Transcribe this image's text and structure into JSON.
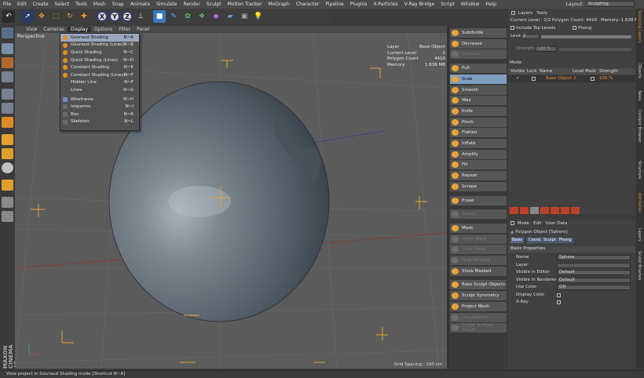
{
  "menubar": {
    "items": [
      "File",
      "Edit",
      "Create",
      "Select",
      "Tools",
      "Mesh",
      "Snap",
      "Animate",
      "Simulate",
      "Render",
      "Sculpt",
      "Motion Tracker",
      "MoGraph",
      "Character",
      "Pipeline",
      "Plugins",
      "X-Particles",
      "V-Ray Bridge",
      "Script",
      "Window",
      "Help"
    ],
    "layout_label": "Layout:",
    "layout_value": "Sculpting"
  },
  "toolbar": {
    "icons": [
      "undo-icon",
      "select-arrow-icon",
      "move-icon",
      "scale-icon",
      "rotate-icon",
      "recent-tools-icon",
      "x-axis-icon",
      "y-axis-icon",
      "z-axis-icon",
      "coordinate-system-icon",
      "cube-icon",
      "pen-icon",
      "subdivision-icon",
      "cloner-icon",
      "deformer-icon",
      "environment-icon",
      "camera-icon",
      "light-icon"
    ],
    "x": "X",
    "y": "Y",
    "z": "Z"
  },
  "viewport_menu": {
    "items": [
      "View",
      "Cameras",
      "Display",
      "Options",
      "Filter",
      "Panel"
    ],
    "active_index": 2
  },
  "viewport": {
    "label": "Perspective",
    "hud": [
      {
        "k": "Layer",
        "v": "Base Object"
      },
      {
        "k": "Current Level",
        "v": "2"
      },
      {
        "k": "Polygon Count",
        "v": "4416"
      },
      {
        "k": "Memory",
        "v": "1.638 MB"
      }
    ],
    "grid_spacing": "Grid Spacing : 100 cm"
  },
  "display_menu": {
    "items": [
      {
        "label": "Gouraud Shading",
        "shortcut": "N~A",
        "icon": "orange",
        "selected": true
      },
      {
        "label": "Gouraud Shading (Lines)",
        "shortcut": "N~B",
        "icon": "orange"
      },
      {
        "label": "Quick Shading",
        "shortcut": "N~C",
        "icon": "orange"
      },
      {
        "label": "Quick Shading (Lines)",
        "shortcut": "N~D",
        "icon": "orange"
      },
      {
        "label": "Constant Shading",
        "shortcut": "N~E",
        "icon": "orange"
      },
      {
        "label": "Constant Shading (Lines)",
        "shortcut": "N~F",
        "icon": "orange"
      },
      {
        "label": "Hidden Line",
        "shortcut": "N~F",
        "icon": "none"
      },
      {
        "label": "Lines",
        "shortcut": "N~G",
        "icon": "none"
      },
      {
        "label": "Wireframe",
        "shortcut": "N~H",
        "icon": "blue",
        "sep_before": true
      },
      {
        "label": "Isoparms",
        "shortcut": "N~I",
        "icon": "gray"
      },
      {
        "label": "Box",
        "shortcut": "N~K",
        "icon": "gray"
      },
      {
        "label": "Skeleton",
        "shortcut": "N~L",
        "icon": "gray"
      }
    ]
  },
  "sculpt_panel": {
    "buttons": [
      {
        "label": "Subdivide"
      },
      {
        "label": "Decrease"
      },
      {
        "label": "Increase",
        "disabled": true
      },
      {
        "label": "Pull",
        "gap_before": true
      },
      {
        "label": "Grab",
        "selected": true
      },
      {
        "label": "Smooth"
      },
      {
        "label": "Wax"
      },
      {
        "label": "Knife"
      },
      {
        "label": "Pinch"
      },
      {
        "label": "Flatten"
      },
      {
        "label": "Inflate"
      },
      {
        "label": "Amplify"
      },
      {
        "label": "Fill"
      },
      {
        "label": "Repeat"
      },
      {
        "label": "Scrape"
      },
      {
        "label": "Erase",
        "gap_before": true
      },
      {
        "label": "Select",
        "disabled": true,
        "gap_before": true
      },
      {
        "label": "Mask",
        "gap_before": true
      },
      {
        "label": "Invert Mask",
        "disabled": true
      },
      {
        "label": "Clear Mask",
        "disabled": true
      },
      {
        "label": "Hide Masked",
        "disabled": true
      },
      {
        "label": "Show Masked"
      },
      {
        "label": "Bake Sculpt Objects",
        "gap_before": true
      },
      {
        "label": "Sculpt Symmetry"
      },
      {
        "label": "Project Mesh"
      },
      {
        "label": "Unsubdivide",
        "disabled": true
      },
      {
        "label": "Sculpt To Pose Morph",
        "disabled": true
      }
    ]
  },
  "layers_panel": {
    "tabs": [
      "Layers",
      "Tools"
    ],
    "current_level": "Current Level : 2/2  Polygon Count: 4416",
    "memory": "Memory: 1.638 MB",
    "include_top_levels": "Include Top Levels",
    "phong": "Phong",
    "level_label": "Level",
    "level_value": "2",
    "strength_label": "Strength",
    "strength_value": "100 %",
    "mode_label": "Mode",
    "columns": [
      "Visible",
      "Lock",
      "Name",
      "Level",
      "Mask",
      "Strength"
    ],
    "row": {
      "name": "Base Object",
      "level": "2",
      "strength": "100 %"
    }
  },
  "attributes": {
    "menu": [
      "Mode",
      "Edit",
      "User Data"
    ],
    "object_title": "Polygon Object [Sphere]",
    "tabs": [
      "Basic",
      "Coord.",
      "Sculpt",
      "Phong"
    ],
    "section": "Basic Properties",
    "fields": [
      {
        "label": "Name",
        "value": "Sphere"
      },
      {
        "label": "Layer",
        "value": ""
      },
      {
        "label": "Visible in Editor",
        "value": "Default"
      },
      {
        "label": "Visible in Renderer",
        "value": "Default"
      },
      {
        "label": "Use Color",
        "value": "Off"
      },
      {
        "label": "Display Color",
        "value": ""
      },
      {
        "label": "X-Ray",
        "value": ""
      }
    ]
  },
  "right_tabs": [
    "Sculpting Layers",
    "Objects",
    "Takes",
    "Content Browser",
    "Structure",
    "Attributes",
    "Layers",
    "Sculpt Brushes"
  ],
  "brand": "MAXON CINEMA 4D",
  "status": "View project in Gouraud Shading mode [Shortcut N~A]"
}
